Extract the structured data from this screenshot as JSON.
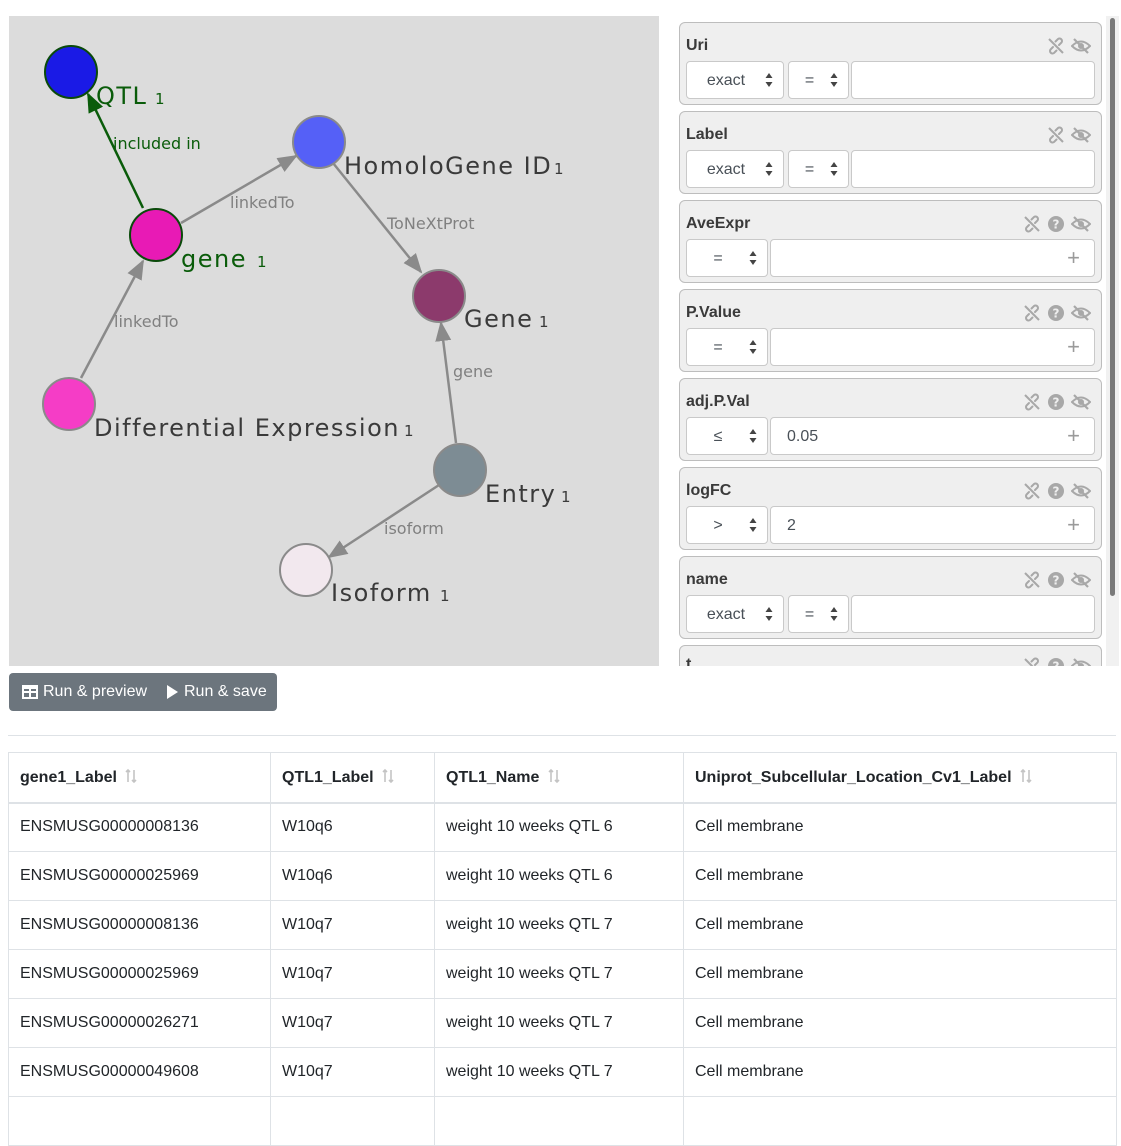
{
  "graph": {
    "nodes": [
      {
        "id": "qtl",
        "label": "QTL",
        "count": "1",
        "color": "#1a1ae6",
        "selected": true
      },
      {
        "id": "homologene",
        "label": "HomoloGene ID",
        "count": "1",
        "color": "#5560f7",
        "selected": false
      },
      {
        "id": "gene_sel",
        "label": "gene",
        "count": "1",
        "color": "#e81ab5",
        "selected": true
      },
      {
        "id": "gene_big",
        "label": "Gene",
        "count": "1",
        "color": "#8c3a6c",
        "selected": false
      },
      {
        "id": "diffexpr",
        "label": "Differential Expression",
        "count": "1",
        "color": "#f53dc6",
        "selected": false
      },
      {
        "id": "entry",
        "label": "Entry",
        "count": "1",
        "color": "#7d8c94",
        "selected": false
      },
      {
        "id": "isoform",
        "label": "Isoform",
        "count": "1",
        "color": "#f2e8ee",
        "selected": false
      }
    ],
    "edges": [
      {
        "label": "included in",
        "selected": true
      },
      {
        "label": "linkedTo",
        "selected": false
      },
      {
        "label": "linkedTo",
        "selected": false
      },
      {
        "label": "ToNeXtProt",
        "selected": false
      },
      {
        "label": "gene",
        "selected": false
      },
      {
        "label": "isoform",
        "selected": false
      }
    ]
  },
  "filters": [
    {
      "title": "Uri",
      "mode": "exact",
      "op": "=",
      "value": "",
      "icons": [
        "unlink-icon",
        "eye-slash-icon"
      ]
    },
    {
      "title": "Label",
      "mode": "exact",
      "op": "=",
      "value": "",
      "icons": [
        "unlink-icon",
        "eye-slash-icon"
      ]
    },
    {
      "title": "AveExpr",
      "mode": "",
      "op": "=",
      "value": "",
      "icons": [
        "unlink-icon",
        "help-icon",
        "eye-slash-icon"
      ]
    },
    {
      "title": "P.Value",
      "mode": "",
      "op": "=",
      "value": "",
      "icons": [
        "unlink-icon",
        "help-icon",
        "eye-slash-icon"
      ]
    },
    {
      "title": "adj.P.Val",
      "mode": "",
      "op": "≤",
      "value": "0.05",
      "icons": [
        "unlink-icon",
        "help-icon",
        "eye-slash-icon"
      ]
    },
    {
      "title": "logFC",
      "mode": "",
      "op": ">",
      "value": "2",
      "icons": [
        "unlink-icon",
        "help-icon",
        "eye-slash-icon"
      ]
    },
    {
      "title": "name",
      "mode": "exact",
      "op": "=",
      "value": "",
      "icons": [
        "unlink-icon",
        "help-icon",
        "eye-slash-icon"
      ]
    },
    {
      "title": "t",
      "mode": "",
      "op": "",
      "value": "",
      "icons": [
        "unlink-icon",
        "help-icon",
        "eye-slash-icon"
      ]
    }
  ],
  "actions": {
    "run_preview": "Run & preview",
    "run_save": "Run & save"
  },
  "table": {
    "columns": [
      "gene1_Label",
      "QTL1_Label",
      "QTL1_Name",
      "Uniprot_Subcellular_Location_Cv1_Label"
    ],
    "rows": [
      [
        "ENSMUSG00000008136",
        "W10q6",
        "weight 10 weeks QTL 6",
        "Cell membrane"
      ],
      [
        "ENSMUSG00000025969",
        "W10q6",
        "weight 10 weeks QTL 6",
        "Cell membrane"
      ],
      [
        "ENSMUSG00000008136",
        "W10q7",
        "weight 10 weeks QTL 7",
        "Cell membrane"
      ],
      [
        "ENSMUSG00000025969",
        "W10q7",
        "weight 10 weeks QTL 7",
        "Cell membrane"
      ],
      [
        "ENSMUSG00000026271",
        "W10q7",
        "weight 10 weeks QTL 7",
        "Cell membrane"
      ],
      [
        "ENSMUSG00000049608",
        "W10q7",
        "weight 10 weeks QTL 7",
        "Cell membrane"
      ],
      [
        "",
        "",
        "",
        ""
      ]
    ]
  }
}
